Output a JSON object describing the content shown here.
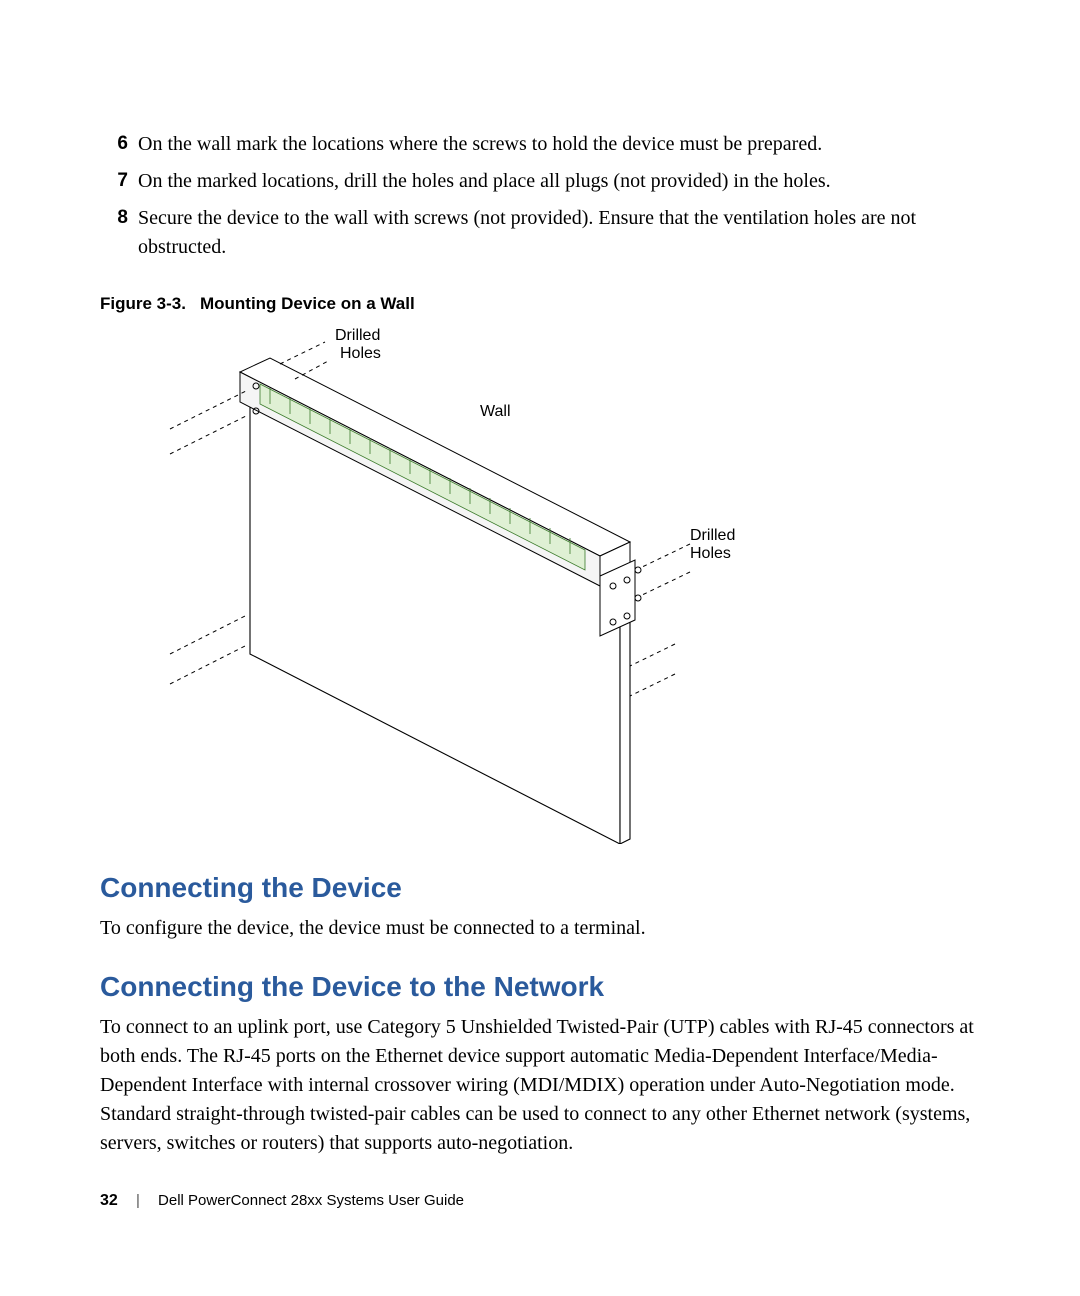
{
  "steps": [
    {
      "num": "6",
      "text": "On the wall mark the locations where the screws to hold the device must be prepared."
    },
    {
      "num": "7",
      "text": "On the marked locations, drill the holes and place all plugs (not provided) in the holes."
    },
    {
      "num": "8",
      "text": "Secure the device to the wall with screws (not provided). Ensure that the ventilation holes are not obstructed."
    }
  ],
  "figure": {
    "number": "Figure 3-3.",
    "title": "Mounting Device on a Wall",
    "labels": {
      "drilled_holes_top": "Drilled\nHoles",
      "wall": "Wall",
      "drilled_holes_right": "Drilled\nHoles"
    }
  },
  "sections": [
    {
      "heading": "Connecting the Device",
      "body": "To configure the device, the device must be connected to a terminal."
    },
    {
      "heading": "Connecting the Device to the Network",
      "body": "To connect to an uplink port, use Category 5 Unshielded Twisted-Pair (UTP) cables with RJ-45 connectors at both ends. The RJ-45 ports on the Ethernet device support automatic Media-Dependent Interface/Media-Dependent Interface with internal crossover wiring (MDI/MDIX) operation under Auto-Negotiation mode. Standard straight-through twisted-pair cables can be used to connect to any other Ethernet network (systems, servers, switches or routers) that supports auto-negotiation."
    }
  ],
  "footer": {
    "page": "32",
    "doc": "Dell PowerConnect 28xx Systems User Guide"
  }
}
